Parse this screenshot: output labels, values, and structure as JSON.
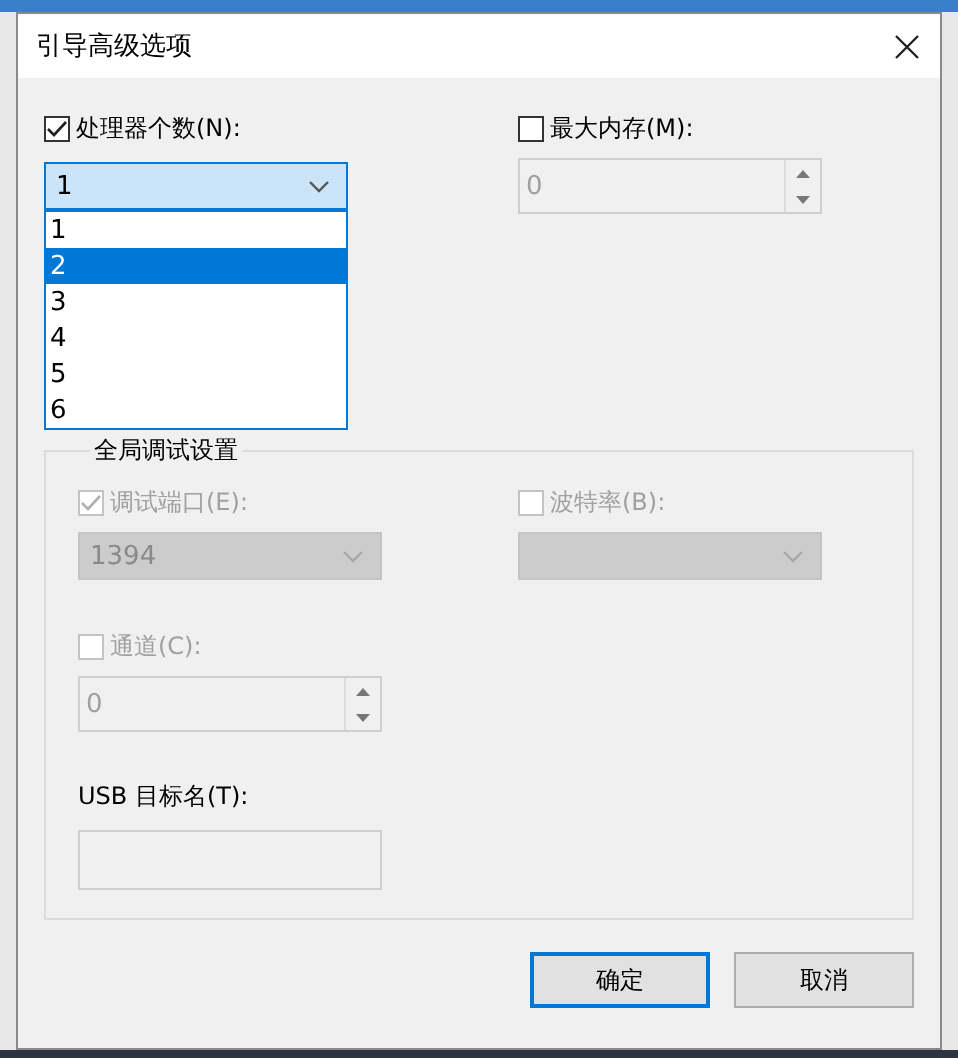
{
  "window": {
    "title": "引导高级选项"
  },
  "processors": {
    "label": "处理器个数(N):",
    "checked": true,
    "value": "1",
    "expanded": true,
    "options": [
      {
        "label": "1",
        "highlighted": false
      },
      {
        "label": "2",
        "highlighted": true
      },
      {
        "label": "3",
        "highlighted": false
      },
      {
        "label": "4",
        "highlighted": false
      },
      {
        "label": "5",
        "highlighted": false
      },
      {
        "label": "6",
        "highlighted": false
      }
    ]
  },
  "max_memory": {
    "label": "最大内存(M):",
    "checked": false,
    "value": "0"
  },
  "debug_settings": {
    "title": "全局调试设置",
    "debug_port": {
      "label": "调试端口(E):",
      "checked": true,
      "disabled": true,
      "value": "1394"
    },
    "baud_rate": {
      "label": "波特率(B):",
      "checked": false,
      "disabled": true
    },
    "channel": {
      "label": "通道(C):",
      "checked": false,
      "disabled": true,
      "value": "0"
    },
    "usb_target": {
      "label": "USB 目标名(T):"
    }
  },
  "buttons": [
    {
      "label": "确定",
      "default": true
    },
    {
      "label": "取消",
      "default": false
    }
  ]
}
